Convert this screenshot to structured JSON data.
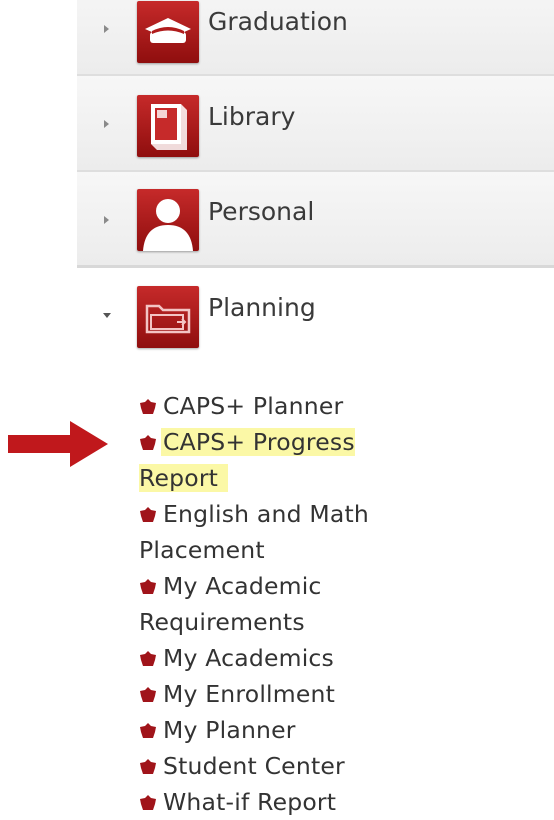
{
  "nav": {
    "sections": [
      {
        "label": "Graduation",
        "icon": "graduation-cap-icon",
        "expanded": false
      },
      {
        "label": "Library",
        "icon": "book-icon",
        "expanded": false
      },
      {
        "label": "Personal",
        "icon": "person-icon",
        "expanded": false
      },
      {
        "label": "Planning",
        "icon": "folder-icon",
        "expanded": true
      }
    ]
  },
  "planning_links": [
    {
      "label": "CAPS+ Planner",
      "highlighted": false
    },
    {
      "label": "CAPS+ Progress Report",
      "highlighted": true
    },
    {
      "label": "English and Math Placement",
      "highlighted": false
    },
    {
      "label": "My Academic Requirements",
      "highlighted": false
    },
    {
      "label": "My Academics",
      "highlighted": false
    },
    {
      "label": "My Enrollment",
      "highlighted": false
    },
    {
      "label": "My Planner",
      "highlighted": false
    },
    {
      "label": "Student Center",
      "highlighted": false
    },
    {
      "label": "What-if Report",
      "highlighted": false
    }
  ],
  "colors": {
    "tile_red": "#b01c1c",
    "bullet_red": "#a0141a",
    "highlight": "#fbf8a6",
    "arrow_red": "#c0181c"
  },
  "annotation": {
    "icon": "red-arrow-icon"
  }
}
